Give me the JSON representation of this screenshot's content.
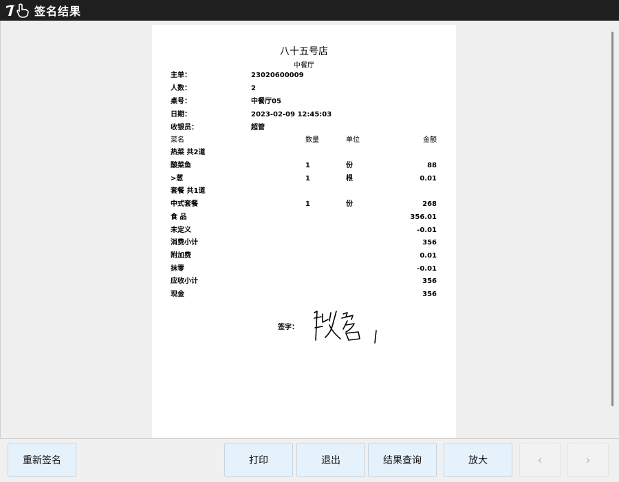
{
  "window": {
    "title": "签名结果",
    "logo_icon": "touch-hand-logo"
  },
  "receipt": {
    "store_name": "八十五号店",
    "hall": "中餐厅",
    "info": [
      {
        "label": "主单：",
        "value": "23020600009"
      },
      {
        "label": "人数：",
        "value": "2"
      },
      {
        "label": "桌号：",
        "value": "中餐厅05"
      },
      {
        "label": "日期：",
        "value": "2023-02-09 12:45:03"
      },
      {
        "label": "收银员：",
        "value": "超管"
      }
    ],
    "columns": {
      "name": "菜名",
      "qty": "数量",
      "unit": "单位",
      "amount": "金额"
    },
    "groups": [
      {
        "title": "热菜 共2道"
      },
      {
        "title": "套餐 共1道"
      }
    ],
    "items": [
      {
        "name": "酸菜鱼",
        "qty": "1",
        "unit": "份",
        "amount": "88"
      },
      {
        "name": ">葱",
        "qty": "1",
        "unit": "根",
        "amount": "0.01"
      },
      {
        "name": "中式套餐",
        "qty": "1",
        "unit": "份",
        "amount": "268"
      }
    ],
    "totals": [
      {
        "label": "食 品",
        "value": "356.01"
      },
      {
        "label": "未定义",
        "value": "-0.01"
      },
      {
        "label": "消费小计",
        "value": "356"
      },
      {
        "label": "附加费",
        "value": "0.01"
      },
      {
        "label": "抹零",
        "value": "-0.01"
      },
      {
        "label": "应收小计",
        "value": "356"
      },
      {
        "label": "现金",
        "value": "356"
      }
    ],
    "signature_label": "签字："
  },
  "buttons": {
    "resign": "重新签名",
    "print": "打印",
    "exit": "退出",
    "query": "结果查询",
    "zoom": "放大",
    "prev": "‹",
    "next": "›"
  }
}
